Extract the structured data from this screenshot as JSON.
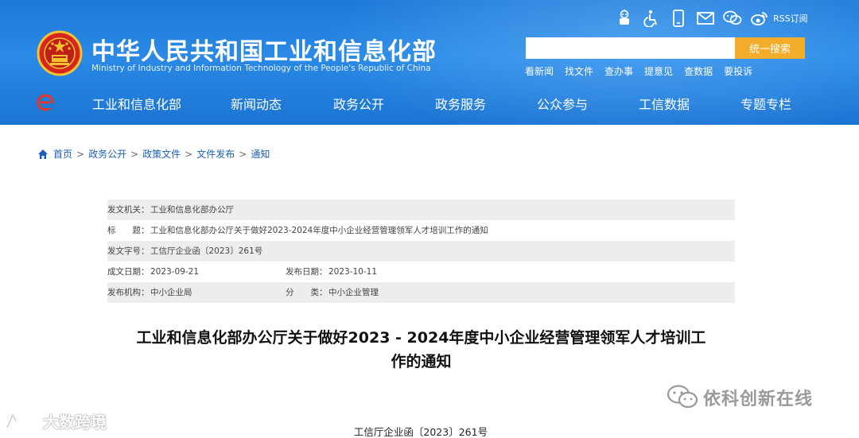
{
  "header": {
    "site_title": "中华人民共和国工业和信息化部",
    "site_subtitle": "Ministry of Industry and Information Technology of the People's Republic of China",
    "top_icons": [
      "robot-icon",
      "accessibility-icon",
      "mobile-icon",
      "mail-icon",
      "wechat-icon",
      "weibo-icon"
    ],
    "rss_label": "RSS订阅",
    "search": {
      "placeholder": "",
      "button_label": "统一搜索"
    },
    "quick_links": [
      "看新闻",
      "找文件",
      "查办事",
      "提意见",
      "查数据",
      "要投诉"
    ],
    "nav": [
      "工业和信息化部",
      "新闻动态",
      "政务公开",
      "政务服务",
      "公众参与",
      "工信数据",
      "专题专栏"
    ],
    "colors": {
      "header_blue": "#1d78d6",
      "search_button": "#f3ad2a",
      "emblem_red": "#d7261e",
      "emblem_gold": "#f4c430"
    }
  },
  "breadcrumb": {
    "items": [
      "首页",
      "政务公开",
      "政策文件",
      "文件发布",
      "通知"
    ],
    "separator": ">"
  },
  "info": {
    "issuer_label": "发文机关：",
    "issuer_value": "工业和信息化部办公厅",
    "title_label": "标　　题：",
    "title_value": "工业和信息化部办公厅关于做好2023-2024年度中小企业经营管理领军人才培训工作的通知",
    "doc_no_label": "发文字号：",
    "doc_no_value": "工信厅企业函〔2023〕261号",
    "created_label": "成文日期：",
    "created_value": "2023-09-21",
    "published_label": "发布日期：",
    "published_value": "2023-10-11",
    "org_label": "发布机构：",
    "org_value": "中小企业局",
    "category_label": "分　　类：",
    "category_value": "中小企业管理"
  },
  "article": {
    "title_line1": "工业和信息化部办公厅关于做好2023 - 2024年度中小企业经营管理领军人才培训工",
    "title_line2": "作的通知",
    "doc_number": "工信厅企业函〔2023〕261号"
  },
  "watermarks": {
    "left": "大数跨境",
    "right": "依科创新在线"
  }
}
